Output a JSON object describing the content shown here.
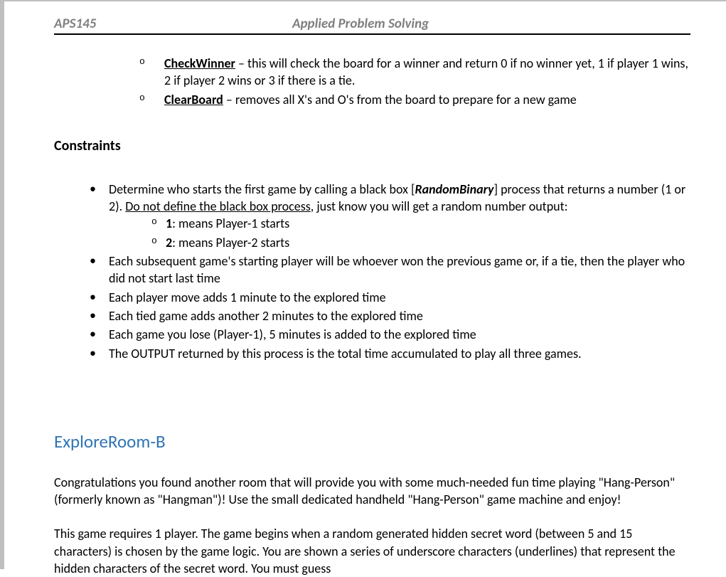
{
  "header": {
    "course": "APS145",
    "title": "Applied Problem Solving"
  },
  "topFns": {
    "checkWinner": {
      "name": "CheckWinner",
      "desc": " – this will check the board for a winner and return 0 if no winner yet, 1 if player 1 wins, 2 if player 2 wins or 3 if there is a tie."
    },
    "clearBoard": {
      "name": "ClearBoard",
      "desc": " – removes all X's and O's from the board to prepare for a new game"
    }
  },
  "constraints": {
    "heading": "Constraints",
    "b1_pre": "Determine who starts the first game by calling a black box [",
    "b1_box": "RandomBinary",
    "b1_mid": "] process that returns a number (1 or 2).  ",
    "b1_u": "Do not define the black box process",
    "b1_post": ", just know you will get a random number output:",
    "sub1_num": "1",
    "sub1_txt": ":  means Player-1 starts",
    "sub2_num": "2",
    "sub2_txt": ":  means Player-2 starts",
    "b2": "Each subsequent game's starting player will be whoever won the previous game or, if a tie, then the player who did not start last time",
    "b3": "Each player move adds 1 minute to the explored time",
    "b4": "Each tied game adds another 2 minutes to the explored time",
    "b5": "Each game you lose (Player-1), 5 minutes is added to the explored time",
    "b6": "The OUTPUT returned by this process is the total time accumulated to play all three games."
  },
  "roomB": {
    "heading": "ExploreRoom-B",
    "p1": "Congratulations you found another room that will provide you with some much-needed fun time playing \"Hang-Person\" (formerly known as \"Hangman\")!  Use the small dedicated handheld \"Hang-Person\" game machine and enjoy!",
    "p2": "This game requires 1 player.  The game begins when a random generated hidden secret word (between 5 and 15 characters) is chosen by the game logic.  You are shown a series of underscore characters (underlines) that represent the hidden characters of the secret word.  You must guess"
  }
}
